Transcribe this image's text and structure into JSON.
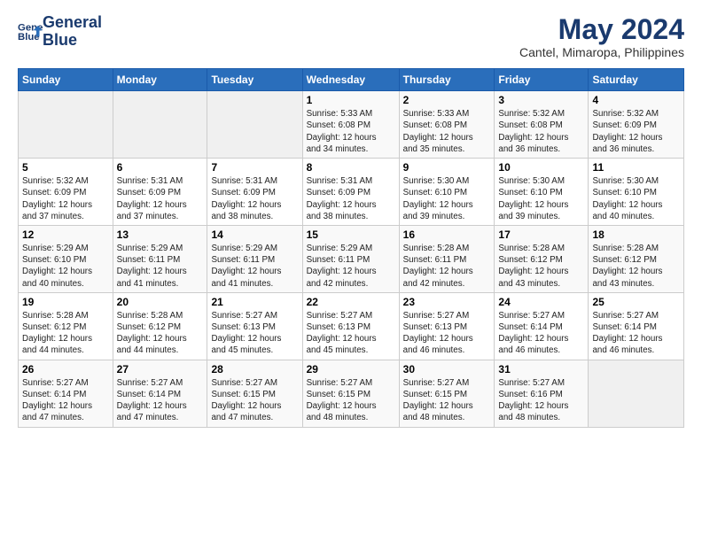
{
  "header": {
    "logo_line1": "General",
    "logo_line2": "Blue",
    "title": "May 2024",
    "subtitle": "Cantel, Mimaropa, Philippines"
  },
  "weekdays": [
    "Sunday",
    "Monday",
    "Tuesday",
    "Wednesday",
    "Thursday",
    "Friday",
    "Saturday"
  ],
  "weeks": [
    [
      {
        "day": "",
        "info": ""
      },
      {
        "day": "",
        "info": ""
      },
      {
        "day": "",
        "info": ""
      },
      {
        "day": "1",
        "info": "Sunrise: 5:33 AM\nSunset: 6:08 PM\nDaylight: 12 hours\nand 34 minutes."
      },
      {
        "day": "2",
        "info": "Sunrise: 5:33 AM\nSunset: 6:08 PM\nDaylight: 12 hours\nand 35 minutes."
      },
      {
        "day": "3",
        "info": "Sunrise: 5:32 AM\nSunset: 6:08 PM\nDaylight: 12 hours\nand 36 minutes."
      },
      {
        "day": "4",
        "info": "Sunrise: 5:32 AM\nSunset: 6:09 PM\nDaylight: 12 hours\nand 36 minutes."
      }
    ],
    [
      {
        "day": "5",
        "info": "Sunrise: 5:32 AM\nSunset: 6:09 PM\nDaylight: 12 hours\nand 37 minutes."
      },
      {
        "day": "6",
        "info": "Sunrise: 5:31 AM\nSunset: 6:09 PM\nDaylight: 12 hours\nand 37 minutes."
      },
      {
        "day": "7",
        "info": "Sunrise: 5:31 AM\nSunset: 6:09 PM\nDaylight: 12 hours\nand 38 minutes."
      },
      {
        "day": "8",
        "info": "Sunrise: 5:31 AM\nSunset: 6:09 PM\nDaylight: 12 hours\nand 38 minutes."
      },
      {
        "day": "9",
        "info": "Sunrise: 5:30 AM\nSunset: 6:10 PM\nDaylight: 12 hours\nand 39 minutes."
      },
      {
        "day": "10",
        "info": "Sunrise: 5:30 AM\nSunset: 6:10 PM\nDaylight: 12 hours\nand 39 minutes."
      },
      {
        "day": "11",
        "info": "Sunrise: 5:30 AM\nSunset: 6:10 PM\nDaylight: 12 hours\nand 40 minutes."
      }
    ],
    [
      {
        "day": "12",
        "info": "Sunrise: 5:29 AM\nSunset: 6:10 PM\nDaylight: 12 hours\nand 40 minutes."
      },
      {
        "day": "13",
        "info": "Sunrise: 5:29 AM\nSunset: 6:11 PM\nDaylight: 12 hours\nand 41 minutes."
      },
      {
        "day": "14",
        "info": "Sunrise: 5:29 AM\nSunset: 6:11 PM\nDaylight: 12 hours\nand 41 minutes."
      },
      {
        "day": "15",
        "info": "Sunrise: 5:29 AM\nSunset: 6:11 PM\nDaylight: 12 hours\nand 42 minutes."
      },
      {
        "day": "16",
        "info": "Sunrise: 5:28 AM\nSunset: 6:11 PM\nDaylight: 12 hours\nand 42 minutes."
      },
      {
        "day": "17",
        "info": "Sunrise: 5:28 AM\nSunset: 6:12 PM\nDaylight: 12 hours\nand 43 minutes."
      },
      {
        "day": "18",
        "info": "Sunrise: 5:28 AM\nSunset: 6:12 PM\nDaylight: 12 hours\nand 43 minutes."
      }
    ],
    [
      {
        "day": "19",
        "info": "Sunrise: 5:28 AM\nSunset: 6:12 PM\nDaylight: 12 hours\nand 44 minutes."
      },
      {
        "day": "20",
        "info": "Sunrise: 5:28 AM\nSunset: 6:12 PM\nDaylight: 12 hours\nand 44 minutes."
      },
      {
        "day": "21",
        "info": "Sunrise: 5:27 AM\nSunset: 6:13 PM\nDaylight: 12 hours\nand 45 minutes."
      },
      {
        "day": "22",
        "info": "Sunrise: 5:27 AM\nSunset: 6:13 PM\nDaylight: 12 hours\nand 45 minutes."
      },
      {
        "day": "23",
        "info": "Sunrise: 5:27 AM\nSunset: 6:13 PM\nDaylight: 12 hours\nand 46 minutes."
      },
      {
        "day": "24",
        "info": "Sunrise: 5:27 AM\nSunset: 6:14 PM\nDaylight: 12 hours\nand 46 minutes."
      },
      {
        "day": "25",
        "info": "Sunrise: 5:27 AM\nSunset: 6:14 PM\nDaylight: 12 hours\nand 46 minutes."
      }
    ],
    [
      {
        "day": "26",
        "info": "Sunrise: 5:27 AM\nSunset: 6:14 PM\nDaylight: 12 hours\nand 47 minutes."
      },
      {
        "day": "27",
        "info": "Sunrise: 5:27 AM\nSunset: 6:14 PM\nDaylight: 12 hours\nand 47 minutes."
      },
      {
        "day": "28",
        "info": "Sunrise: 5:27 AM\nSunset: 6:15 PM\nDaylight: 12 hours\nand 47 minutes."
      },
      {
        "day": "29",
        "info": "Sunrise: 5:27 AM\nSunset: 6:15 PM\nDaylight: 12 hours\nand 48 minutes."
      },
      {
        "day": "30",
        "info": "Sunrise: 5:27 AM\nSunset: 6:15 PM\nDaylight: 12 hours\nand 48 minutes."
      },
      {
        "day": "31",
        "info": "Sunrise: 5:27 AM\nSunset: 6:16 PM\nDaylight: 12 hours\nand 48 minutes."
      },
      {
        "day": "",
        "info": ""
      }
    ]
  ]
}
